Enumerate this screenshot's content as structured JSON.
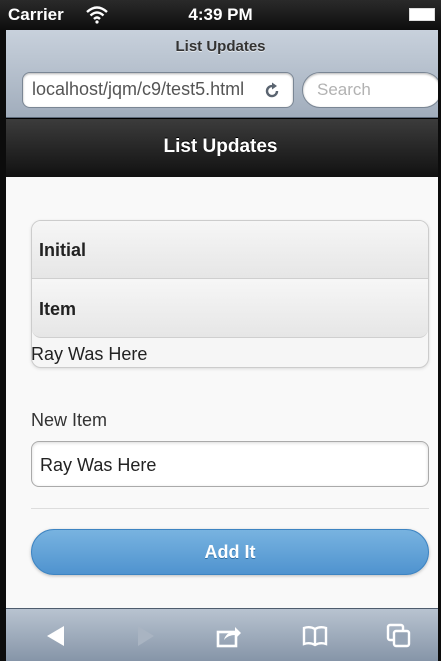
{
  "status_bar": {
    "carrier": "Carrier",
    "time": "4:39 PM"
  },
  "browser": {
    "title": "List Updates",
    "url": "localhost/jqm/c9/test5.html",
    "search_placeholder": "Search"
  },
  "page": {
    "header_title": "List Updates",
    "list_items": [
      "Initial",
      "Item"
    ],
    "appended_text": "Ray Was Here",
    "field_label": "New Item",
    "field_value": "Ray Was Here",
    "button_label": "Add It"
  },
  "colors": {
    "button_blue": "#5a9ad4",
    "header_black": "#1a1a1a",
    "toolbar_blue": "#97a5b6"
  },
  "toolbar": {
    "icons": [
      "back-icon",
      "forward-icon",
      "share-icon",
      "bookmarks-icon",
      "tabs-icon"
    ]
  }
}
